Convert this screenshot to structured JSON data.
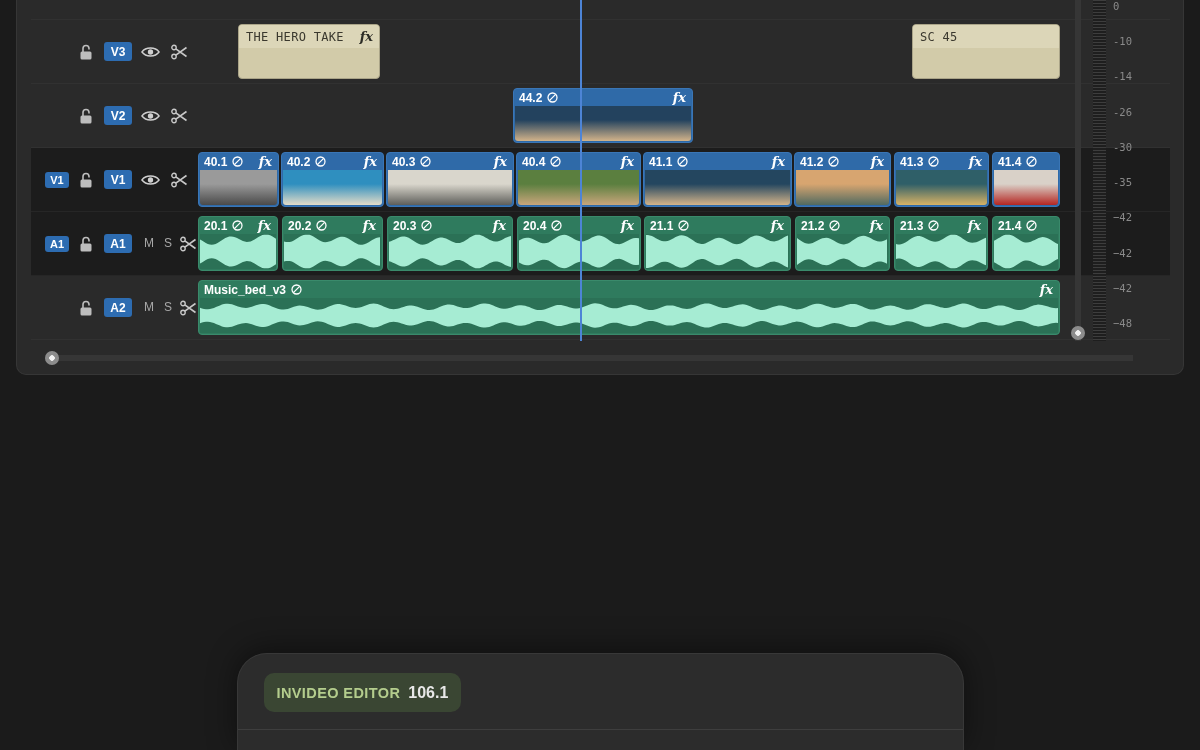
{
  "tracks": [
    {
      "kind": "video",
      "label": "V3",
      "selected": false,
      "locked": false,
      "visible": true,
      "clips": [
        {
          "kind": "title",
          "name": "THE HERO TAKE",
          "effect": "fx"
        },
        {
          "kind": "title",
          "name": "SC 45"
        }
      ]
    },
    {
      "kind": "video",
      "label": "V2",
      "selected": false,
      "locked": false,
      "visible": true,
      "clips": [
        {
          "kind": "video",
          "name": "44.2",
          "effect": "fx"
        }
      ]
    },
    {
      "kind": "video",
      "source": "V1",
      "label": "V1",
      "selected": true,
      "locked": false,
      "visible": true,
      "clips": [
        {
          "kind": "video",
          "name": "40.1",
          "effect": "fx"
        },
        {
          "kind": "video",
          "name": "40.2",
          "effect": "fx"
        },
        {
          "kind": "video",
          "name": "40.3",
          "effect": "fx"
        },
        {
          "kind": "video",
          "name": "40.4",
          "effect": "fx"
        },
        {
          "kind": "video",
          "name": "41.1",
          "effect": "fx"
        },
        {
          "kind": "video",
          "name": "41.2",
          "effect": "fx"
        },
        {
          "kind": "video",
          "name": "41.3",
          "effect": "fx"
        },
        {
          "kind": "video",
          "name": "41.4"
        }
      ]
    },
    {
      "kind": "audio",
      "source": "A1",
      "label": "A1",
      "selected": true,
      "locked": false,
      "mute": {
        "label": "M",
        "on": false
      },
      "solo": {
        "label": "S",
        "on": false
      },
      "clips": [
        {
          "kind": "audio",
          "name": "20.1",
          "effect": "fx"
        },
        {
          "kind": "audio",
          "name": "20.2",
          "effect": "fx"
        },
        {
          "kind": "audio",
          "name": "20.3",
          "effect": "fx"
        },
        {
          "kind": "audio",
          "name": "20.4",
          "effect": "fx"
        },
        {
          "kind": "audio",
          "name": "21.1",
          "effect": "fx"
        },
        {
          "kind": "audio",
          "name": "21.2",
          "effect": "fx"
        },
        {
          "kind": "audio",
          "name": "21.3",
          "effect": "fx"
        },
        {
          "kind": "audio",
          "name": "21.4"
        }
      ]
    },
    {
      "kind": "audio",
      "label": "A2",
      "selected": false,
      "locked": false,
      "mute": {
        "label": "M",
        "on": false
      },
      "solo": {
        "label": "S",
        "on": false
      },
      "clips": [
        {
          "kind": "audio",
          "name": "Music_bed_v3",
          "effect": "fx"
        }
      ]
    }
  ],
  "meter_scale": [
    "0",
    "-10",
    "-14",
    "-26",
    "-30",
    "-35",
    "−42",
    "−42",
    "−42",
    "−48"
  ],
  "app_badge": {
    "name": "INVIDEO EDITOR",
    "version": "106.1"
  }
}
